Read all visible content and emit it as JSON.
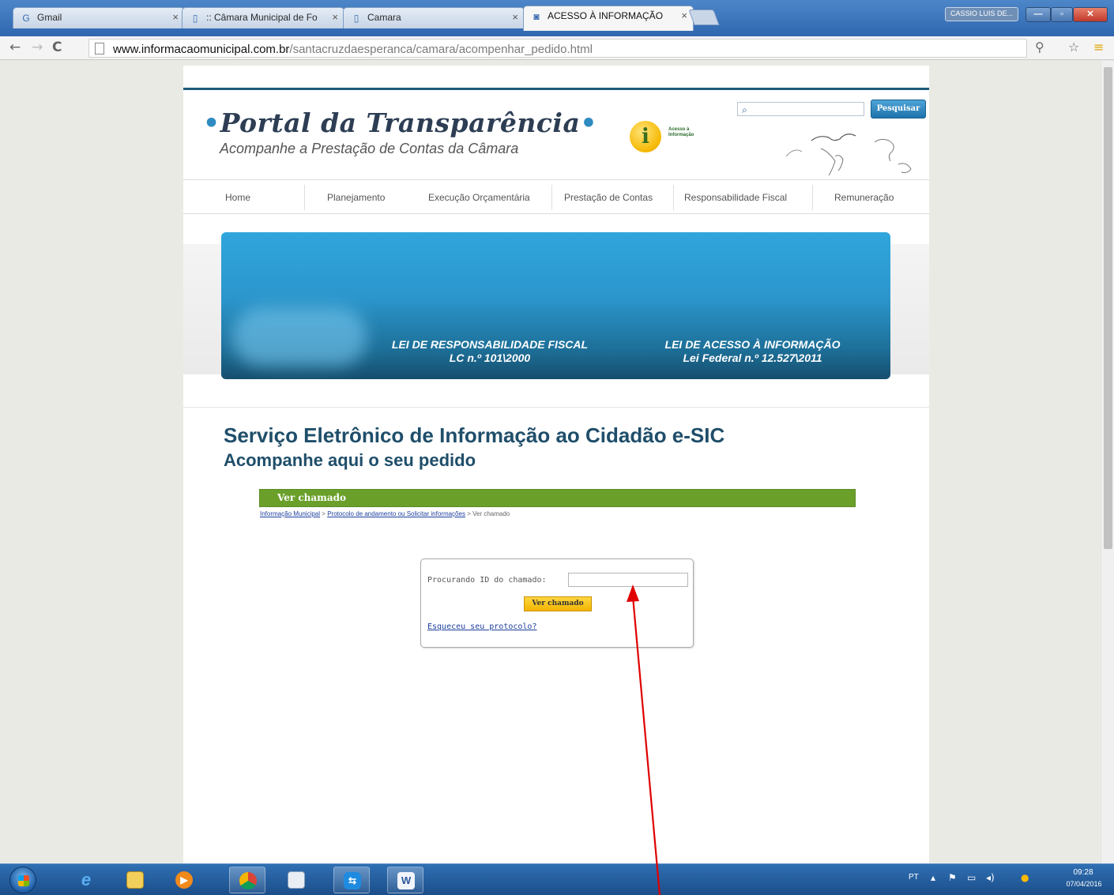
{
  "browser": {
    "tabs": [
      {
        "label": "Gmail",
        "icon": "gmail-icon"
      },
      {
        "label": ":: Câmara Municipal de Fo",
        "icon": "page-icon"
      },
      {
        "label": "Camara",
        "icon": "page-icon"
      },
      {
        "label": "ACESSO À INFORMAÇÃO",
        "icon": "info-icon"
      }
    ],
    "user_badge": "CASSIO LUIS DE...",
    "url_domain": "www.informacaomunicipal.com.br",
    "url_path": "/santacruzdaesperanca/camara/acompenhar_pedido.html"
  },
  "site": {
    "logo_title": "Portal da Transparência",
    "logo_subtitle": "Acompanhe a Prestação de Contas da Câmara",
    "info_badge_letter": "i",
    "info_badge_text": "Acesso à Informação",
    "search_placeholder": "",
    "search_button": "Pesquisar",
    "nav": [
      "Home",
      "Planejamento",
      "Execução Orçamentária",
      "Prestação de Contas",
      "Responsabilidade Fiscal",
      "Remuneração"
    ],
    "banner": {
      "left_line1": "LEI DE RESPONSABILIDADE FISCAL",
      "left_line2": "LC n.º 101\\2000",
      "right_line1": "LEI DE ACESSO À INFORMAÇÃO",
      "right_line2": "Lei Federal n.º 12.527\\2011"
    }
  },
  "content": {
    "title": "Serviço Eletrônico de Informação ao Cidadão e-SIC",
    "subtitle": "Acompanhe aqui o seu pedido",
    "section_bar": "Ver chamado",
    "breadcrumb": {
      "link1": "Informação Municipal",
      "link2": "Protocolo de andamento ou Solicitar informações",
      "current": "Ver chamado",
      "separator": ">"
    },
    "lookup": {
      "label": "Procurando ID do chamado:",
      "input_value": "",
      "button": "Ver chamado",
      "forgot_link": "Esqueceu seu protocolo?"
    }
  },
  "taskbar": {
    "apps": [
      "internet-explorer-icon",
      "file-explorer-icon",
      "media-player-icon",
      "chrome-icon",
      "notepad-icon",
      "teamviewer-icon",
      "word-icon"
    ],
    "language": "PT",
    "time": "09:28",
    "date": "07/04/2016"
  },
  "colors": {
    "accent_blue": "#1f4e6a",
    "bar_green": "#6aa02a",
    "button_yellow": "#f2b400",
    "annotation_arrow": "#e00000"
  }
}
